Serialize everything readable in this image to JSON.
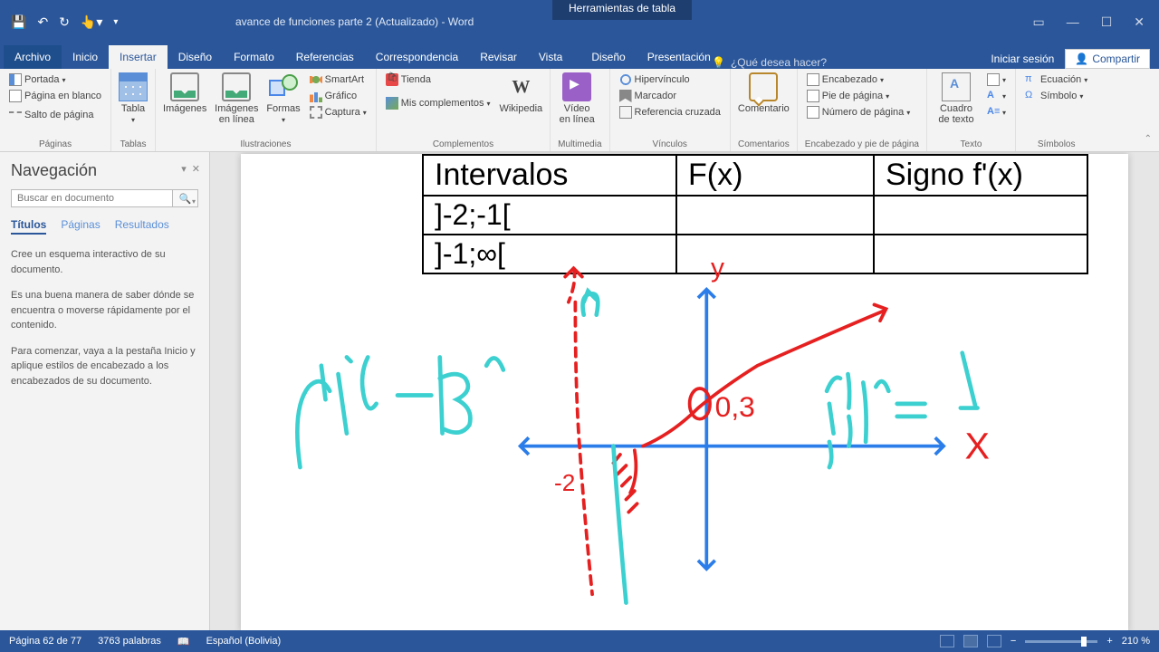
{
  "app": {
    "document_title": "avance de funciones parte 2 (Actualizado) - Word",
    "table_tools": "Herramientas de tabla"
  },
  "tabs": {
    "archivo": "Archivo",
    "inicio": "Inicio",
    "insertar": "Insertar",
    "diseno": "Diseño",
    "formato": "Formato",
    "referencias": "Referencias",
    "correspondencia": "Correspondencia",
    "revisar": "Revisar",
    "vista": "Vista",
    "diseno2": "Diseño",
    "presentacion": "Presentación",
    "tell_me": "¿Qué desea hacer?",
    "login": "Iniciar sesión",
    "share": "Compartir"
  },
  "ribbon": {
    "paginas": {
      "portada": "Portada",
      "blanco": "Página en blanco",
      "salto": "Salto de página",
      "label": "Páginas"
    },
    "tablas": {
      "tabla": "Tabla",
      "label": "Tablas"
    },
    "ilustraciones": {
      "imagenes": "Imágenes",
      "imagenes_linea": "Imágenes en línea",
      "formas": "Formas",
      "smartart": "SmartArt",
      "grafico": "Gráfico",
      "captura": "Captura",
      "label": "Ilustraciones"
    },
    "complementos": {
      "tienda": "Tienda",
      "mis": "Mis complementos",
      "wikipedia": "Wikipedia",
      "label": "Complementos"
    },
    "multimedia": {
      "video": "Vídeo en línea",
      "label": "Multimedia"
    },
    "vinculos": {
      "hipervinculo": "Hipervínculo",
      "marcador": "Marcador",
      "referencia_cruzada": "Referencia cruzada",
      "label": "Vínculos"
    },
    "comentarios": {
      "comentario": "Comentario",
      "label": "Comentarios"
    },
    "encabezado": {
      "encabezado": "Encabezado",
      "pie": "Pie de página",
      "numero": "Número de página",
      "label": "Encabezado y pie de página"
    },
    "texto": {
      "cuadro": "Cuadro de texto",
      "label": "Texto"
    },
    "simbolos": {
      "ecuacion": "Ecuación",
      "simbolo": "Símbolo",
      "label": "Símbolos"
    }
  },
  "nav": {
    "title": "Navegación",
    "search_placeholder": "Buscar en documento",
    "tabs": {
      "titulos": "Títulos",
      "paginas": "Páginas",
      "resultados": "Resultados"
    },
    "p1": "Cree un esquema interactivo de su documento.",
    "p2": "Es una buena manera de saber dónde se encuentra o moverse rápidamente por el contenido.",
    "p3": "Para comenzar, vaya a la pestaña Inicio y aplique estilos de encabezado a los encabezados de su documento."
  },
  "table": {
    "h1": "Intervalos",
    "h2": "F(x)",
    "h3": "Signo f'(x)",
    "r1c1": "]-2;-1[",
    "r2c1": "]-1;∞["
  },
  "status": {
    "page": "Página 62 de 77",
    "words": "3763 palabras",
    "lang": "Español (Bolivia)",
    "zoom": "210 %"
  }
}
